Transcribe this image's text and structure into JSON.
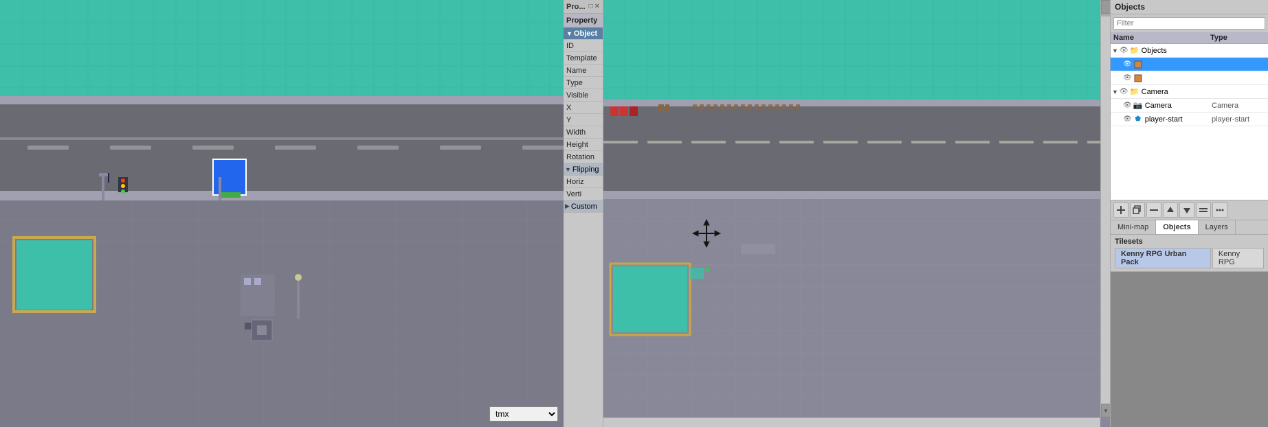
{
  "leftPanel": {
    "dropdownOptions": [
      "tmx"
    ],
    "dropdownValue": "tmx"
  },
  "propertiesPanel": {
    "title": "Pro...",
    "headerIcons": [
      "□",
      "✕"
    ],
    "sections": [
      {
        "label": "Property",
        "type": "header",
        "bold": true
      },
      {
        "label": "Object",
        "type": "section",
        "expanded": true
      },
      {
        "label": "ID",
        "type": "row"
      },
      {
        "label": "Template",
        "type": "row"
      },
      {
        "label": "Name",
        "type": "row"
      },
      {
        "label": "Type",
        "type": "row"
      },
      {
        "label": "Visible",
        "type": "row"
      },
      {
        "label": "X",
        "type": "row"
      },
      {
        "label": "Y",
        "type": "row"
      },
      {
        "label": "Width",
        "type": "row"
      },
      {
        "label": "Height",
        "type": "row"
      },
      {
        "label": "Rotation",
        "type": "row"
      },
      {
        "label": "Flipping",
        "type": "section-collapse",
        "expanded": true
      },
      {
        "label": "Horiz",
        "type": "row"
      },
      {
        "label": "Verti",
        "type": "row"
      },
      {
        "label": "Custom",
        "type": "section-collapse",
        "expanded": false
      }
    ]
  },
  "rightPanel": {
    "objectsTitle": "Objects",
    "filterPlaceholder": "Filter",
    "treeHeaders": {
      "name": "Name",
      "type": "Type"
    },
    "treeItems": [
      {
        "id": "objects-root",
        "label": "Objects",
        "type": "",
        "level": 0,
        "expanded": true,
        "hasEye": true,
        "iconType": "folder",
        "selected": false
      },
      {
        "id": "obj-sprite1",
        "label": "",
        "type": "",
        "level": 1,
        "hasEye": true,
        "iconType": "sprite",
        "selected": true
      },
      {
        "id": "obj-sprite2",
        "label": "",
        "type": "",
        "level": 1,
        "hasEye": true,
        "iconType": "sprite",
        "selected": false
      },
      {
        "id": "camera-group",
        "label": "Camera",
        "type": "",
        "level": 0,
        "expanded": false,
        "hasEye": true,
        "iconType": "group",
        "selected": false
      },
      {
        "id": "camera-obj",
        "label": "Camera",
        "type": "Camera",
        "level": 1,
        "hasEye": true,
        "iconType": "camera",
        "selected": false
      },
      {
        "id": "player-start",
        "label": "player-start",
        "type": "player-start",
        "level": 1,
        "hasEye": true,
        "iconType": "point",
        "selected": false
      }
    ],
    "toolbarButtons": [
      "⬛",
      "⧉",
      "⬛",
      "▲",
      "▼",
      "⬛",
      "⬛"
    ],
    "tabs": [
      {
        "label": "Mini-map",
        "active": false
      },
      {
        "label": "Objects",
        "active": true
      },
      {
        "label": "Layers",
        "active": false
      }
    ],
    "tilesetsLabel": "Tilesets",
    "tilesetTabs": [
      {
        "label": "Kenny RPG Urban Pack",
        "active": true
      },
      {
        "label": "Kenny RPG",
        "active": false
      }
    ]
  }
}
